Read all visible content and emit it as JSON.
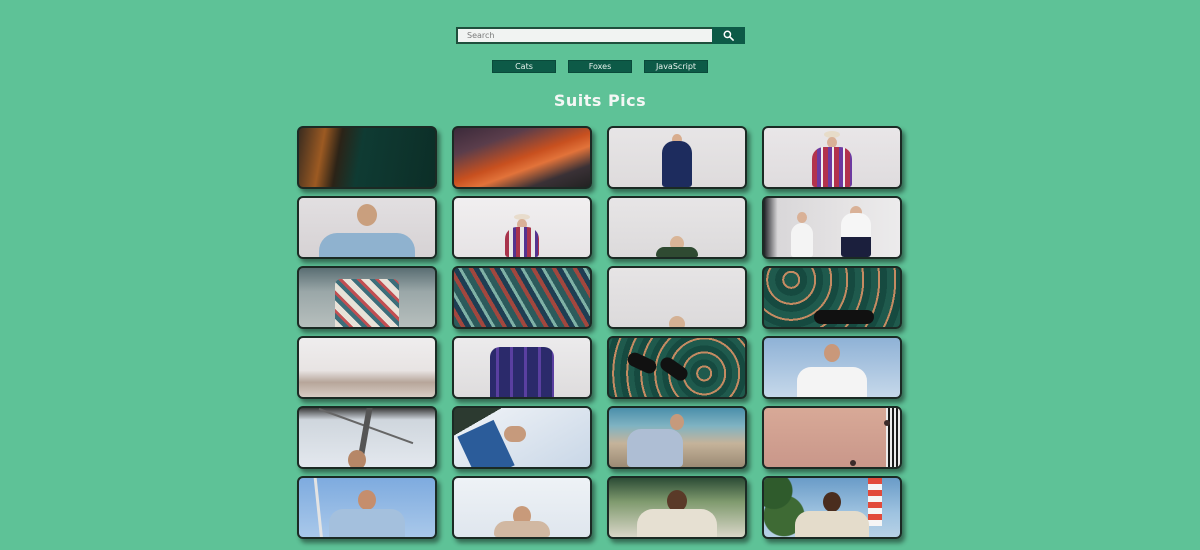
{
  "search": {
    "placeholder": "Search",
    "value": "",
    "button_icon": "magnifier-icon"
  },
  "topics": [
    {
      "label": "Cats"
    },
    {
      "label": "Foxes"
    },
    {
      "label": "JavaScript"
    }
  ],
  "gallery": {
    "title": "Suits Pics",
    "images": [
      {
        "desc": "dark green suit with orange leather detail"
      },
      {
        "desc": "orange leather accessory on dark background"
      },
      {
        "desc": "woman in navy suit against grey wall"
      },
      {
        "desc": "woman in plaid blazer with white hat"
      },
      {
        "desc": "blonde woman in light blue blazer"
      },
      {
        "desc": "woman in plaid jacket and hat seated"
      },
      {
        "desc": "woman in green sitting low in frame"
      },
      {
        "desc": "two women in white shirts with mirror"
      },
      {
        "desc": "patterned shirt on hanger"
      },
      {
        "desc": "colorful patterned suit lining"
      },
      {
        "desc": "woman peeking from bottom of frame"
      },
      {
        "desc": "brown shoes on patterned green rug"
      },
      {
        "desc": "hazy pale city skyline"
      },
      {
        "desc": "mannequin in purple plaid suit"
      },
      {
        "desc": "black loafers on green patterned floor"
      },
      {
        "desc": "man in white shirt against blue sky"
      },
      {
        "desc": "man seen from below under sail mast"
      },
      {
        "desc": "close-up of light blue suit sleeve"
      },
      {
        "desc": "man in grey suit sitting on rocks by sea"
      },
      {
        "desc": "close-up of pink blazer and buttons"
      },
      {
        "desc": "man in light blue suit holding mast"
      },
      {
        "desc": "man in beige suit against pale sky"
      },
      {
        "desc": "man in cream suit with palm trees"
      },
      {
        "desc": "man in cream suit near lighthouse"
      }
    ]
  }
}
